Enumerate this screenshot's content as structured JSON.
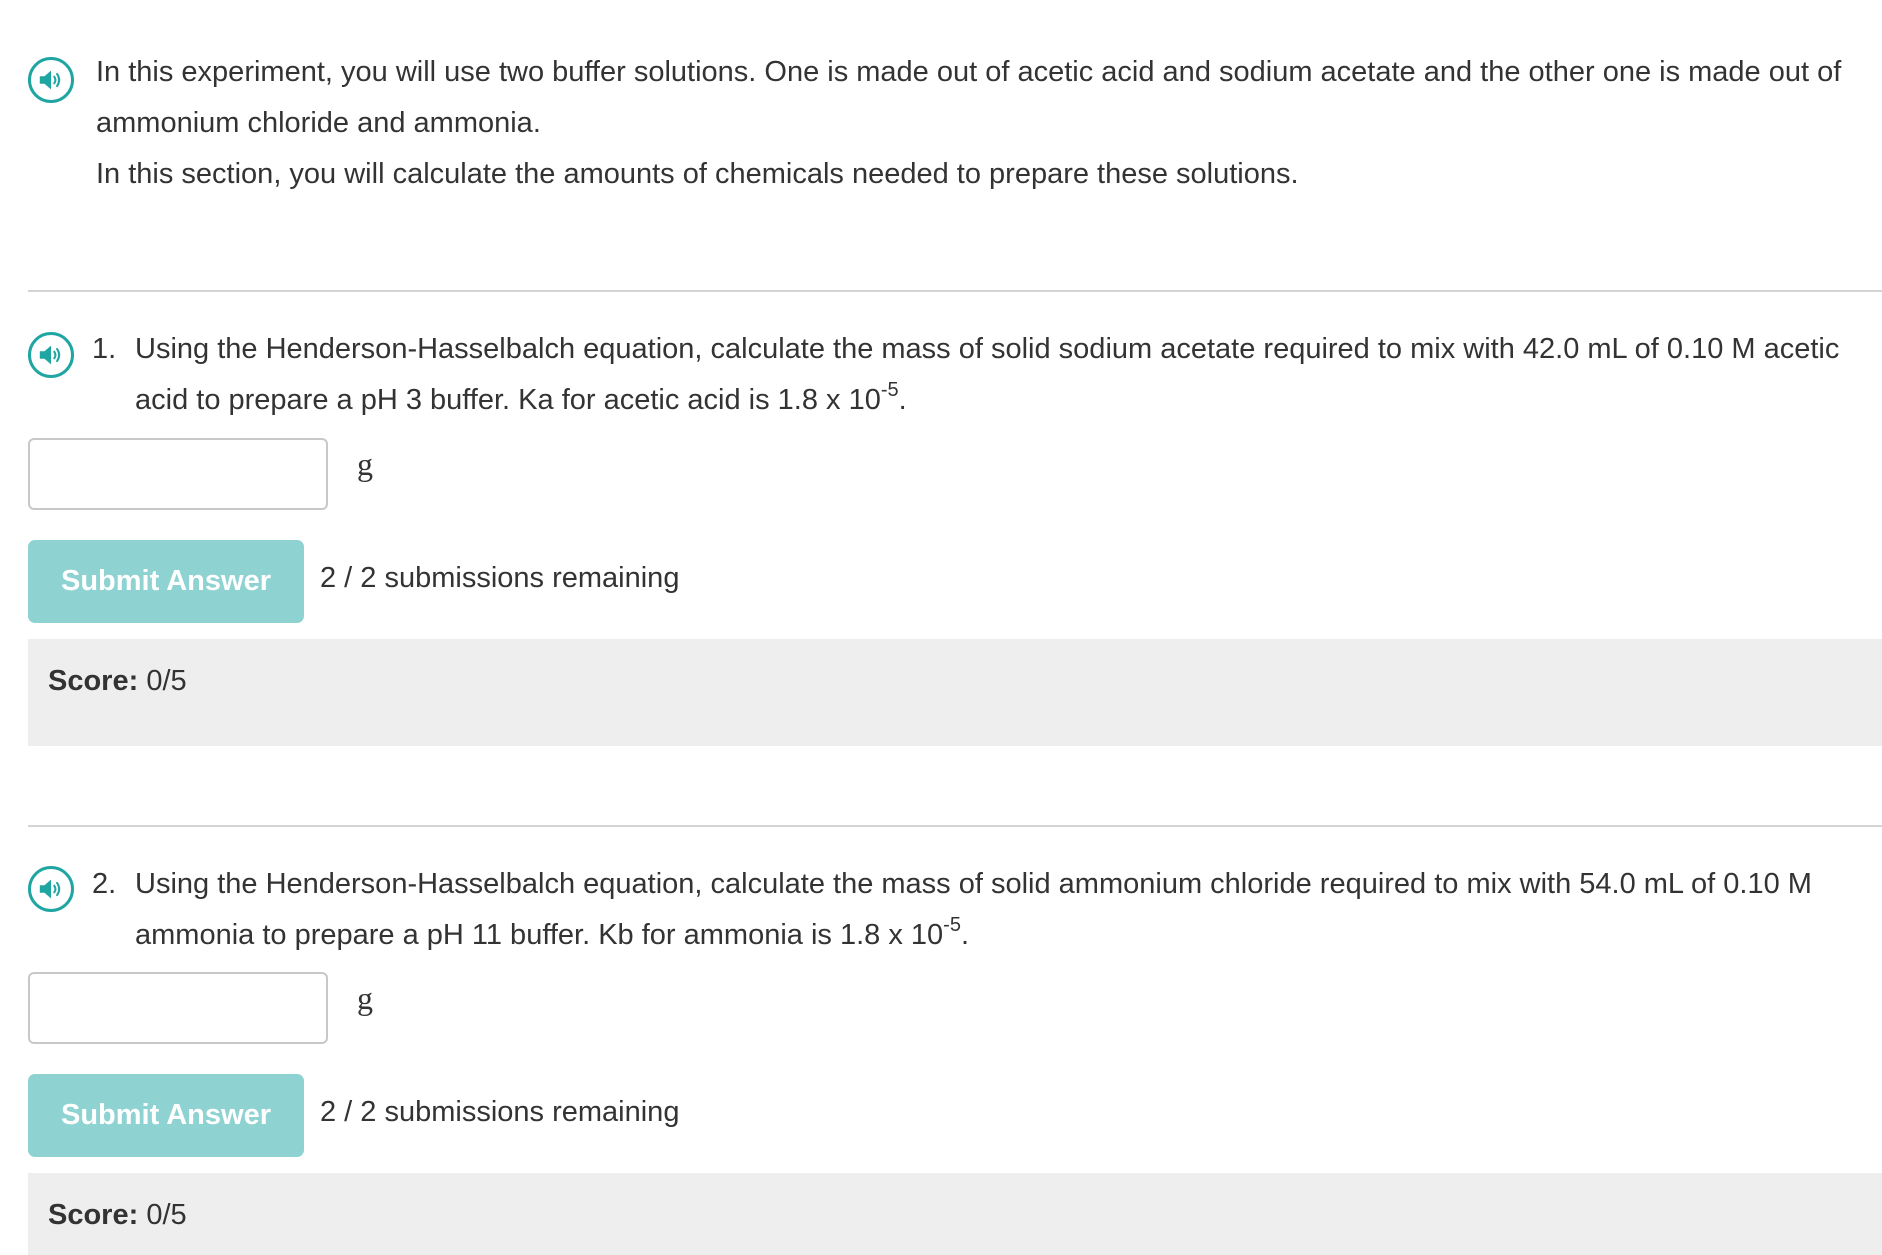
{
  "intro": {
    "paragraph1": "In this experiment, you will use two buffer solutions. One is made out of acetic acid and sodium acetate and the other one is made out of ammonium chloride and ammonia.",
    "paragraph2": "In this section, you will calculate the amounts of chemicals needed to prepare these solutions."
  },
  "questions": [
    {
      "number": "1.",
      "text": "Using the Henderson-Hasselbalch equation, calculate the mass of solid sodium acetate required to mix with 42.0 mL of 0.10 M acetic acid to prepare a pH 3 buffer. Ka for acetic acid is 1.8 x 10",
      "exponent": "-5",
      "end": ".",
      "answer_value": "",
      "unit": "g",
      "submit_label": "Submit Answer",
      "remaining": "2 / 2 submissions remaining",
      "score_label": "Score:",
      "score_value": "0/5"
    },
    {
      "number": "2.",
      "text": "Using the Henderson-Hasselbalch equation, calculate the mass of solid ammonium chloride required to mix with 54.0 mL of 0.10 M ammonia to prepare a pH 11 buffer. Kb for ammonia is 1.8 x 10",
      "exponent": "-5",
      "end": ".",
      "answer_value": "",
      "unit": "g",
      "submit_label": "Submit Answer",
      "remaining": "2 / 2 submissions remaining",
      "score_label": "Score:",
      "score_value": "0/5"
    }
  ],
  "icons": {
    "audio": "speaker-icon"
  },
  "colors": {
    "accent": "#1fa5a2",
    "submit_button": "#8ed3d2",
    "score_background": "#eeeeee",
    "divider": "#d4d4d4",
    "text": "#333333"
  }
}
